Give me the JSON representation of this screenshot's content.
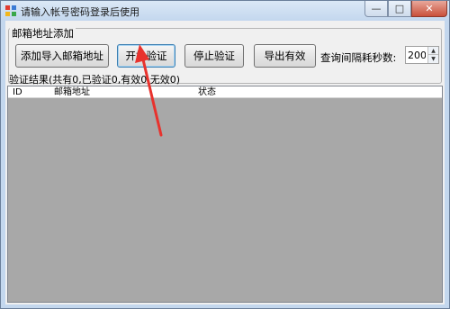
{
  "window": {
    "title": "请输入帐号密码登录后使用",
    "minimize_glyph": "—",
    "maximize_glyph": "□",
    "close_glyph": "✕"
  },
  "group": {
    "legend": "邮箱地址添加"
  },
  "toolbar": {
    "import_label": "添加导入邮箱地址",
    "start_label": "开始验证",
    "stop_label": "停止验证",
    "export_label": "导出有效",
    "interval_label": "查询间隔耗秒数:",
    "interval_value": "200"
  },
  "results": {
    "summary": "验证结果(共有0,已验证0,有效0,无效0)",
    "columns": [
      "ID",
      "邮箱地址",
      "状态"
    ]
  },
  "annotation": {
    "arrow_color": "#e8322d"
  }
}
